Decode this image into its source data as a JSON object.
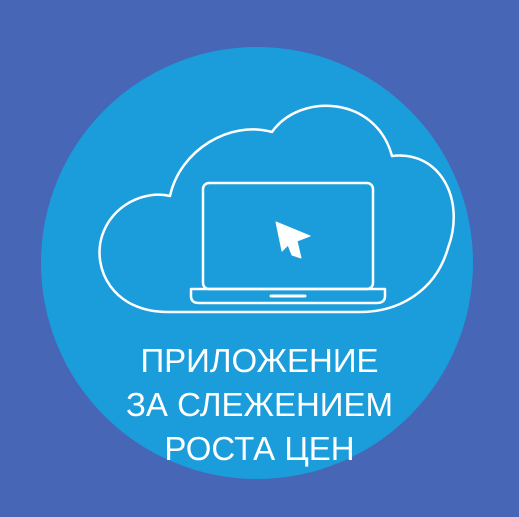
{
  "colors": {
    "background": "#4766b5",
    "circle": "#1b9ddc",
    "line": "#ffffff"
  },
  "icons": {
    "cloud": "cloud-icon",
    "laptop": "laptop-icon",
    "cursor": "cursor-arrow-icon"
  },
  "caption": {
    "line1": "ПРИЛОЖЕНИЕ",
    "line2": "ЗА СЛЕЖЕНИЕМ",
    "line3": "РОСТА ЦЕН"
  }
}
